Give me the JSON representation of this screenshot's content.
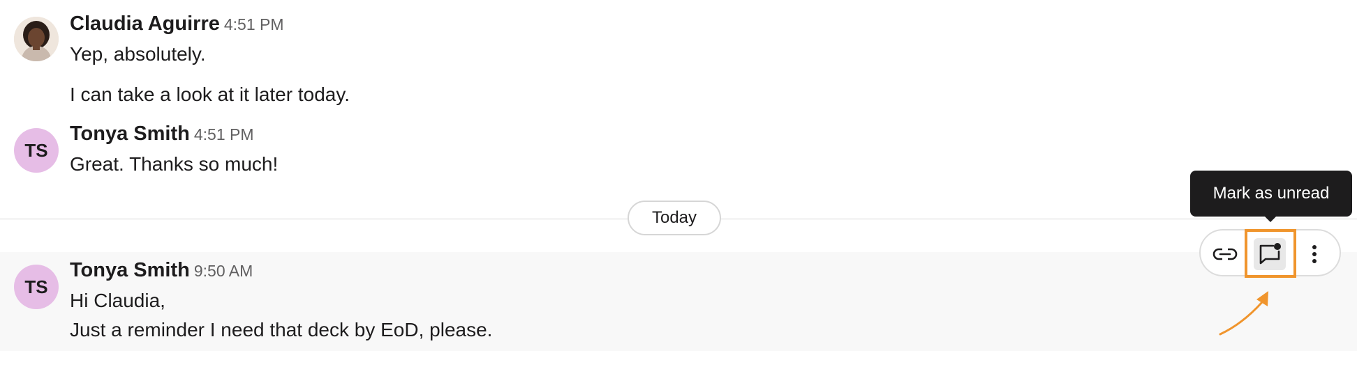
{
  "messages": [
    {
      "author": "Claudia Aguirre",
      "time": "4:51 PM",
      "avatar": {
        "type": "photo",
        "icon": "user-photo-avatar"
      },
      "lines": [
        "Yep, absolutely.",
        "I can take a look at it later today."
      ]
    },
    {
      "author": "Tonya Smith",
      "time": "4:51 PM",
      "avatar": {
        "type": "initials",
        "initials": "TS",
        "color": "#e6bde6"
      },
      "lines": [
        "Great. Thanks so much!"
      ]
    }
  ],
  "divider": {
    "label": "Today"
  },
  "hovered_message": {
    "author": "Tonya Smith",
    "time": "9:50 AM",
    "avatar": {
      "type": "initials",
      "initials": "TS",
      "color": "#e6bde6"
    },
    "lines": [
      "Hi Claudia,",
      "Just a reminder I need that deck by EoD, please."
    ]
  },
  "toolbar": {
    "buttons": [
      {
        "icon": "link-icon",
        "label": "Copy link"
      },
      {
        "icon": "mark-unread-icon",
        "label": "Mark as unread",
        "active": true
      },
      {
        "icon": "more-vertical-icon",
        "label": "More actions"
      }
    ],
    "tooltip": "Mark as unread"
  },
  "colors": {
    "accent_annotation": "#f0952d",
    "tooltip_bg": "#1d1c1d",
    "hover_row_bg": "#f8f8f8"
  }
}
